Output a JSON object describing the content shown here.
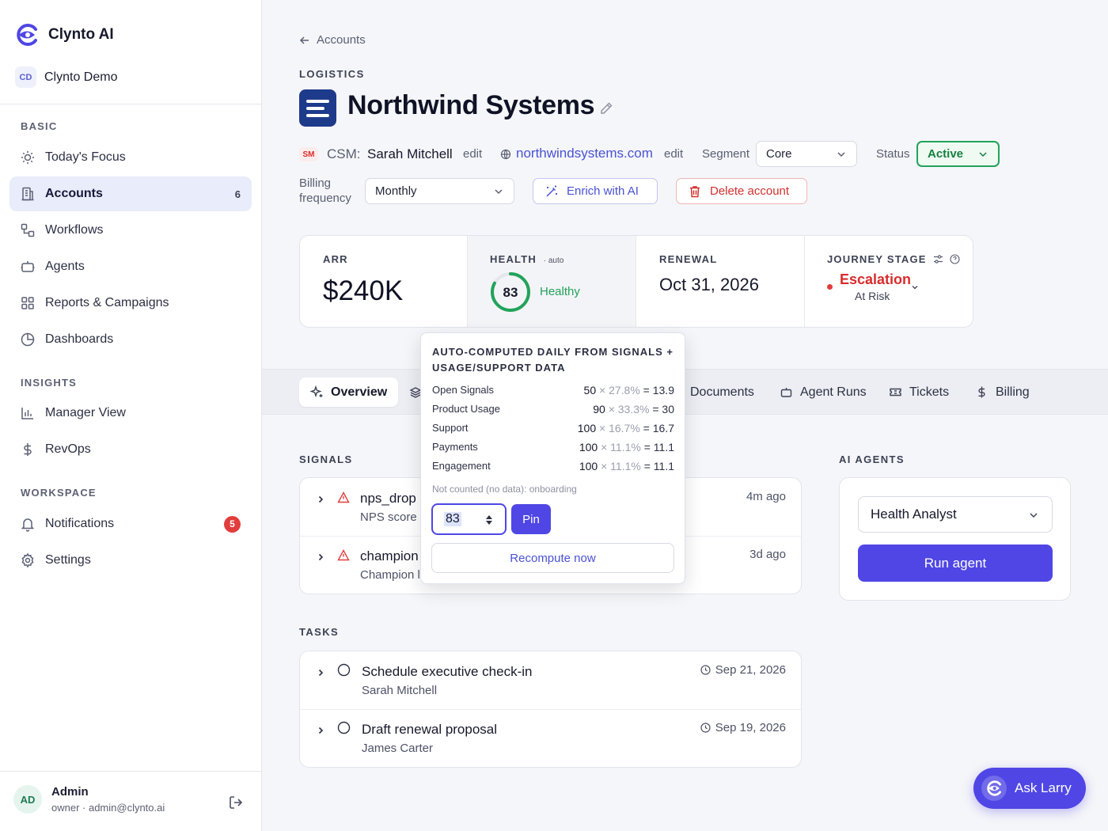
{
  "brand": {
    "name": "Clynto AI"
  },
  "org": {
    "initials": "CD",
    "name": "Clynto Demo"
  },
  "sidebar": {
    "sections": [
      "BASIC",
      "INSIGHTS",
      "WORKSPACE"
    ],
    "items": [
      {
        "label": "Today's Focus",
        "icon": "sun-icon"
      },
      {
        "label": "Accounts",
        "icon": "building-icon",
        "count": "6"
      },
      {
        "label": "Workflows",
        "icon": "workflow-icon"
      },
      {
        "label": "Agents",
        "icon": "bot-icon"
      },
      {
        "label": "Reports & Campaigns",
        "icon": "grid-icon"
      },
      {
        "label": "Dashboards",
        "icon": "pie-chart-icon"
      },
      {
        "label": "Manager View",
        "icon": "bar-chart-icon"
      },
      {
        "label": "RevOps",
        "icon": "dollar-icon"
      },
      {
        "label": "Notifications",
        "icon": "bell-icon",
        "badge": "5"
      },
      {
        "label": "Settings",
        "icon": "gear-icon"
      }
    ]
  },
  "user": {
    "initials": "AD",
    "name": "Admin",
    "sub": "owner · admin@clynto.ai"
  },
  "header": {
    "back": "Accounts",
    "industry": "LOGISTICS",
    "title": "Northwind Systems",
    "csm_badge": "SM",
    "csm_label": "CSM:",
    "csm_name": "Sarah Mitchell",
    "edit": "edit",
    "website": "northwindsystems.com",
    "segment_label": "Segment",
    "segment_value": "Core",
    "status_label": "Status",
    "status_value": "Active",
    "billing_label_1": "Billing",
    "billing_label_2": "frequency",
    "billing_value": "Monthly",
    "enrich_label": "Enrich with AI",
    "delete_label": "Delete account"
  },
  "metrics": {
    "arr_label": "ARR",
    "arr_value": "$240K",
    "health_label": "HEALTH",
    "health_auto": "· auto",
    "health_score": "83",
    "health_score_value": 83,
    "health_status": "Healthy",
    "renewal_label": "RENEWAL",
    "renewal_value": "Oct 31, 2026",
    "journey_label": "JOURNEY STAGE",
    "journey_value": "Escalation",
    "journey_sub": "At Risk"
  },
  "tabs": [
    {
      "label": "Overview",
      "icon": "sparkle-icon"
    },
    {
      "label": "Documents",
      "icon": ""
    },
    {
      "label": "Agent Runs",
      "icon": "bot-icon"
    },
    {
      "label": "Tickets",
      "icon": "ticket-icon"
    },
    {
      "label": "Billing",
      "icon": "dollar-icon"
    }
  ],
  "signals": {
    "label": "SIGNALS",
    "items": [
      {
        "title": "nps_drop",
        "sub": "NPS score (",
        "time": "4m ago"
      },
      {
        "title": "champion",
        "sub": "Champion l",
        "time": "3d ago"
      }
    ]
  },
  "tasks": {
    "label": "TASKS",
    "items": [
      {
        "title": "Schedule executive check-in",
        "sub": "Sarah Mitchell",
        "date": "Sep 21, 2026"
      },
      {
        "title": "Draft renewal proposal",
        "sub": "James Carter",
        "date": "Sep 19, 2026"
      }
    ]
  },
  "ai_agents": {
    "label": "AI AGENTS",
    "selected": "Health Analyst",
    "run_label": "Run agent"
  },
  "ask": {
    "label": "Ask Larry"
  },
  "popover": {
    "heading": "AUTO-COMPUTED DAILY FROM SIGNALS + USAGE/SUPPORT DATA",
    "rows": [
      {
        "label": "Open Signals",
        "score": "50",
        "weight": "× 27.8%",
        "result": "= 13.9"
      },
      {
        "label": "Product Usage",
        "score": "90",
        "weight": "× 33.3%",
        "result": "= 30"
      },
      {
        "label": "Support",
        "score": "100",
        "weight": "× 16.7%",
        "result": "= 16.7"
      },
      {
        "label": "Payments",
        "score": "100",
        "weight": "× 11.1%",
        "result": "= 11.1"
      },
      {
        "label": "Engagement",
        "score": "100",
        "weight": "× 11.1%",
        "result": "= 11.1"
      }
    ],
    "note": "Not counted (no data): onboarding",
    "pin_value": "83",
    "pin_label": "Pin",
    "recompute_label": "Recompute now"
  },
  "colors": {
    "accent": "#4f46e5",
    "healthy": "#22a35a",
    "danger": "#d32f2f"
  }
}
